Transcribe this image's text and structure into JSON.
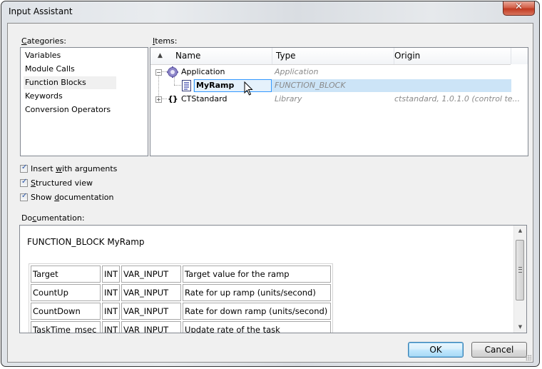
{
  "window": {
    "title": "Input Assistant",
    "close_icon": "close-x-icon"
  },
  "categories": {
    "label_prefix": "",
    "label_mnemonic": "C",
    "label_rest": "ategories:",
    "items": [
      {
        "label": "Variables",
        "selected": false
      },
      {
        "label": "Module Calls",
        "selected": false
      },
      {
        "label": "Function Blocks",
        "selected": true
      },
      {
        "label": "Keywords",
        "selected": false
      },
      {
        "label": "Conversion Operators",
        "selected": false
      }
    ]
  },
  "items": {
    "label_mnemonic": "I",
    "label_rest": "tems:",
    "columns": {
      "sort_icon": "sort-ascending-icon",
      "name": "Name",
      "type": "Type",
      "origin": "Origin"
    },
    "rows": [
      {
        "name": "Application",
        "type": "Application",
        "origin": "",
        "icon": "application-gear-icon",
        "expander": "−",
        "selected": false
      },
      {
        "name": "MyRamp",
        "type": "FUNCTION_BLOCK",
        "origin": "",
        "icon": "function-block-document-icon",
        "selected": true
      },
      {
        "name": "CTStandard",
        "type": "Library",
        "origin": "ctstandard, 1.0.1.0 (control te...",
        "icon": "library-braces-icon",
        "expander": "+",
        "selected": false
      }
    ]
  },
  "options": {
    "insert_with_arguments": {
      "pre": "Insert ",
      "mn": "w",
      "post": "ith arguments",
      "checked": true
    },
    "structured_view": {
      "pre": "",
      "mn": "S",
      "post": "tructured view",
      "checked": true
    },
    "show_documentation": {
      "pre": "Show ",
      "mn": "d",
      "post": "ocumentation",
      "checked": true
    }
  },
  "documentation": {
    "label_pre": "Do",
    "label_mn": "c",
    "label_post": "umentation:",
    "heading": "FUNCTION_BLOCK MyRamp",
    "rows": [
      {
        "name": "Target",
        "type": "INT",
        "kind": "VAR_INPUT",
        "desc": "Target value for the ramp"
      },
      {
        "name": "CountUp",
        "type": "INT",
        "kind": "VAR_INPUT",
        "desc": "Rate for up ramp (units/second)"
      },
      {
        "name": "CountDown",
        "type": "INT",
        "kind": "VAR_INPUT",
        "desc": "Rate for down ramp (units/second)"
      },
      {
        "name": "TaskTime_msec",
        "type": "INT",
        "kind": "VAR_INPUT",
        "desc": "Update rate of the task"
      }
    ]
  },
  "buttons": {
    "ok": "OK",
    "cancel": "Cancel"
  },
  "colors": {
    "selection": "#cce4f7",
    "selection_border": "#3399ff",
    "close_button": "#c13b22"
  }
}
